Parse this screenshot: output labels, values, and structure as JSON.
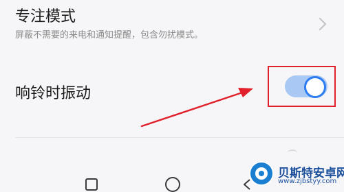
{
  "focus_mode": {
    "title": "专注模式",
    "subtitle": "屏蔽不需要的来电和通知提醒，包含勿扰模式。",
    "chevron_icon": "chevron-right-icon"
  },
  "ring_vibrate": {
    "label": "响铃时振动",
    "toggle_state": "on",
    "toggle_color": "#2d7cf0"
  },
  "annotation": {
    "highlight_color": "#e0202a",
    "arrow_icon": "arrow-pointer"
  },
  "navbar": {
    "recent_icon": "square-icon",
    "home_icon": "circle-icon",
    "back_icon": "back-triangle-icon"
  },
  "watermark": {
    "name": "贝斯特安卓网",
    "url": "www.zjbstyy.com"
  }
}
